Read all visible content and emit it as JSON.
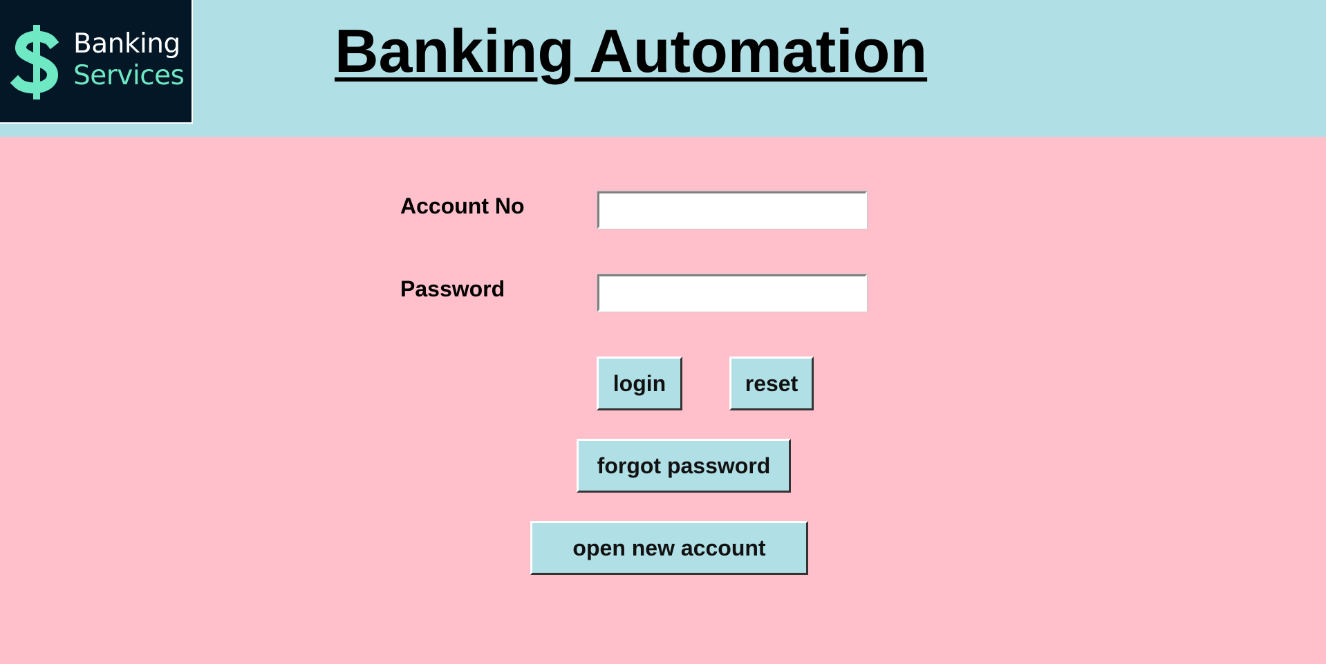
{
  "header": {
    "logo": {
      "line1": "Banking",
      "line2": "Services",
      "icon": "dollar-sign-icon",
      "colors": {
        "background": "#041726",
        "accent": "#6fe8c4",
        "text": "#ffffff"
      }
    },
    "title": "Banking Automation",
    "background": "#b0dfe5"
  },
  "form": {
    "account_label": "Account No",
    "account_value": "",
    "password_label": "Password",
    "password_value": ""
  },
  "buttons": {
    "login": "login",
    "reset": "reset",
    "forgot_password": "forgot password",
    "open_account": "open new account"
  },
  "colors": {
    "page_background": "#ffc0cb",
    "button_background": "#b0dfe5"
  }
}
